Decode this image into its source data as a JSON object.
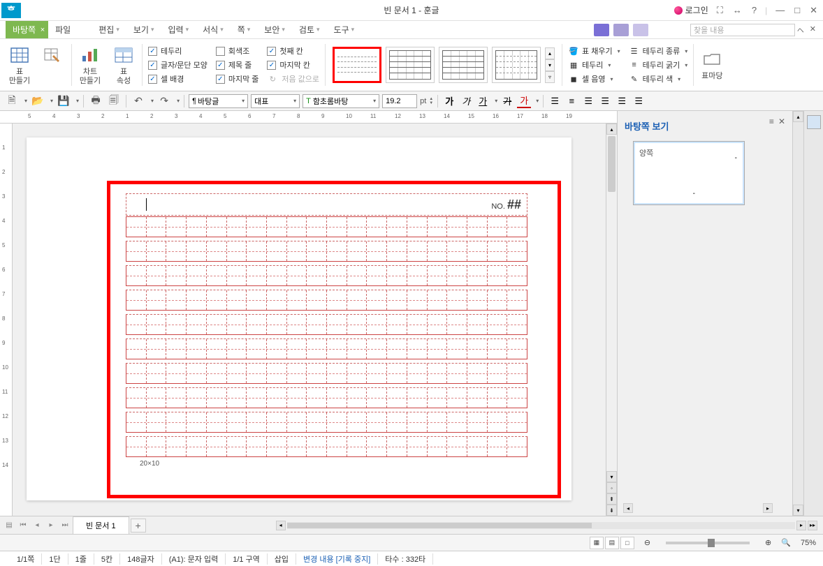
{
  "title": "빈 문서 1 - 훈글",
  "logo": "ᄒ",
  "login": "로그인",
  "menus": {
    "active": "바탕쪽",
    "items": [
      "파일",
      "편집",
      "보기",
      "입력",
      "서식",
      "쪽",
      "보안",
      "검토",
      "도구"
    ]
  },
  "search_placeholder": "찾을 내용",
  "ribbon": {
    "make_table": "표\n만들기",
    "chart_make": "차트\n만들기",
    "table_props": "표\n속성",
    "checks1": {
      "border": "테두리",
      "charpara": "글자/문단 모양",
      "cellbg": "셀 배경"
    },
    "checks2": {
      "gray": "회색조",
      "titlerow": "제목 줄",
      "lastrow": "마지막 줄"
    },
    "checks3": {
      "firstcol": "첫째 칸",
      "lastcol": "마지막 칸",
      "same": "저음 값으로"
    },
    "fill": "표 채우기",
    "border_btn": "테두리",
    "shade": "셀 음영",
    "border_type": "테두리 종류",
    "border_weight": "테두리 굵기",
    "border_color": "테두리 색",
    "table_yard": "표마당"
  },
  "toolbar": {
    "style_combo": "바탕글",
    "rep_combo": "대표",
    "font_combo": "함초롬바탕",
    "font_size": "19.2",
    "font_unit": "pt"
  },
  "doc": {
    "no_label": "NO.",
    "no_value": "##",
    "footer": "20×10"
  },
  "side": {
    "title": "바탕쪽 보기",
    "thumb_label": "양쪽"
  },
  "tab": {
    "name": "빈 문서 1"
  },
  "status_bottom": {
    "zoom": "75%"
  },
  "status": {
    "page": "1/1쪽",
    "dan": "1단",
    "line": "1줄",
    "col": "5칸",
    "chars": "148글자",
    "mode": "(A1): 문자 입력",
    "section": "1/1 구역",
    "insert": "삽입",
    "change": "변경 내용 [기록 중지]",
    "strokes": "타수 : 332타"
  }
}
